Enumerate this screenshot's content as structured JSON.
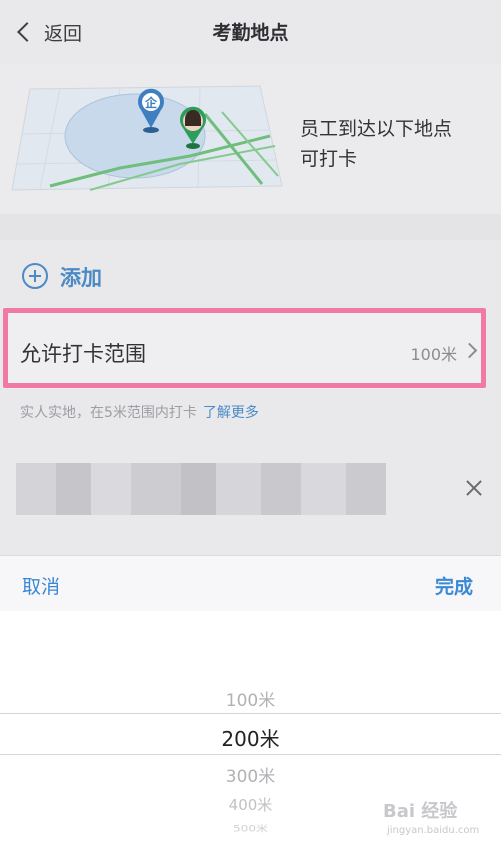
{
  "nav": {
    "back_label": "返回",
    "title": "考勤地点"
  },
  "banner": {
    "text_line1": "员工到达以下地点",
    "text_line2": "可打卡",
    "marker_label": "企"
  },
  "add": {
    "label": "添加"
  },
  "range": {
    "label": "允许打卡范围",
    "value": "100米"
  },
  "hint": {
    "text": "实人实地，在5米范围内打卡",
    "link": "了解更多"
  },
  "picker": {
    "cancel_label": "取消",
    "done_label": "完成",
    "options": [
      "100米",
      "200米",
      "300米",
      "400米",
      "500米"
    ],
    "selected": "200米"
  },
  "watermark": {
    "main": "Bai 经验",
    "sub": "jingyan.baidu.com"
  },
  "colors": {
    "accent": "#3b88d4",
    "highlight": "#f07aa3",
    "link": "#4b8ac5"
  }
}
